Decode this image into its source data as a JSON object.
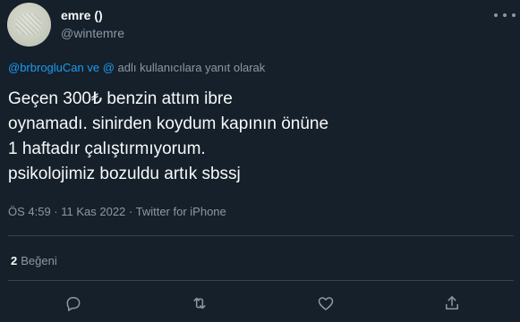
{
  "author": {
    "display_name": "emre ()",
    "handle": "@wintemre"
  },
  "reply_context": {
    "mentions": "@brbrogluCan ve @",
    "suffix": " adlı kullanıcılara yanıt olarak"
  },
  "tweet": {
    "lines": [
      "Geçen 300₺ benzin attım ibre",
      "oynamadı. sinirden koydum kapının önüne",
      "1 haftadır çalıştırmıyorum.",
      "psikolojimiz bozuldu artık sbssj"
    ],
    "meta": "ÖS 4:59 · 11 Kas 2022 · Twitter for iPhone"
  },
  "engagement": {
    "likes_count": "2",
    "likes_label": "Beğeni"
  },
  "actions": {
    "icons": [
      "reply-icon",
      "retweet-icon",
      "like-icon",
      "share-icon"
    ]
  },
  "colors": {
    "background": "#15202b",
    "text": "#f7f9f9",
    "muted": "#8b98a5",
    "accent": "#1d9bf0",
    "divider": "#38444d"
  }
}
